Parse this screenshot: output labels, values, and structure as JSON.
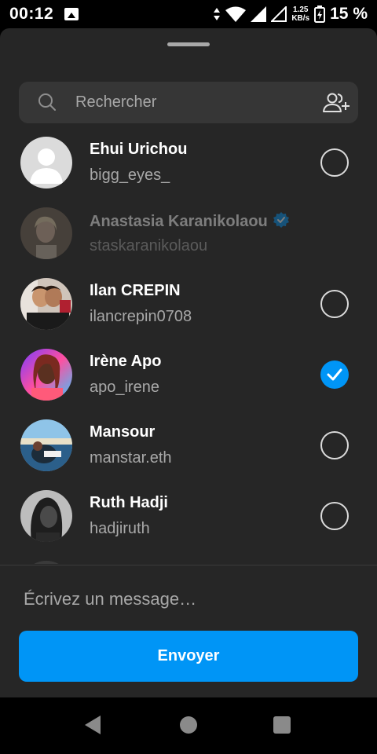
{
  "status_bar": {
    "time": "00:12",
    "speed_value": "1.25",
    "speed_unit": "KB/s",
    "battery": "15 %"
  },
  "search": {
    "placeholder": "Rechercher"
  },
  "contacts": [
    {
      "name": "Ehui Urichou",
      "username": "bigg_eyes_",
      "selected": false,
      "verified": false,
      "enabled": true
    },
    {
      "name": "Anastasia Karanikolaou",
      "username": "staskaranikolaou",
      "selected": false,
      "verified": true,
      "enabled": false
    },
    {
      "name": "Ilan CREPIN",
      "username": "ilancrepin0708",
      "selected": false,
      "verified": false,
      "enabled": true
    },
    {
      "name": "Irène Apo",
      "username": "apo_irene",
      "selected": true,
      "verified": false,
      "enabled": true
    },
    {
      "name": "Mansour",
      "username": "manstar.eth",
      "selected": false,
      "verified": false,
      "enabled": true
    },
    {
      "name": "Ruth Hadji",
      "username": "hadjiruth",
      "selected": false,
      "verified": false,
      "enabled": true
    }
  ],
  "composer": {
    "placeholder": "Écrivez un message…",
    "send_label": "Envoyer"
  },
  "colors": {
    "accent": "#0095f6",
    "sheet_background": "#262626",
    "search_background": "#363636",
    "secondary_text": "#a8a8a8"
  }
}
